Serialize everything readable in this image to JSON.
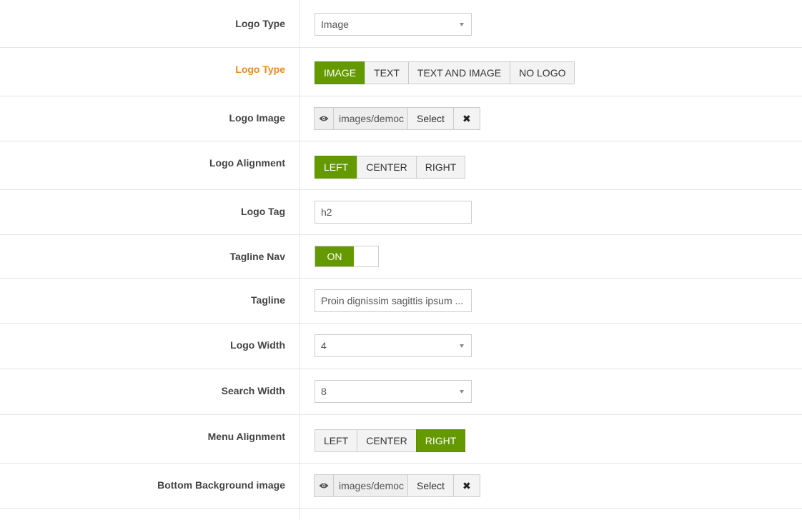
{
  "rows": {
    "logo_type_select": {
      "label": "Logo Type",
      "value": "Image"
    },
    "logo_type_buttons": {
      "label": "Logo Type",
      "options": [
        "IMAGE",
        "TEXT",
        "TEXT AND IMAGE",
        "NO LOGO"
      ],
      "selected": "IMAGE",
      "label_color": "#f08a18"
    },
    "logo_image": {
      "label": "Logo Image",
      "path": "images/democ",
      "select_label": "Select",
      "clear_label": "✖"
    },
    "logo_alignment": {
      "label": "Logo Alignment",
      "options": [
        "LEFT",
        "CENTER",
        "RIGHT"
      ],
      "selected": "LEFT"
    },
    "logo_tag": {
      "label": "Logo Tag",
      "value": "h2"
    },
    "tagline_nav": {
      "label": "Tagline Nav",
      "state": "ON"
    },
    "tagline": {
      "label": "Tagline",
      "value": "Proin dignissim sagittis ipsum  ..."
    },
    "logo_width": {
      "label": "Logo Width",
      "value": "4"
    },
    "search_width": {
      "label": "Search Width",
      "value": "8"
    },
    "menu_alignment": {
      "label": "Menu Alignment",
      "options": [
        "LEFT",
        "CENTER",
        "RIGHT"
      ],
      "selected": "RIGHT"
    },
    "bottom_bg_image": {
      "label": "Bottom Background image",
      "path": "images/democ",
      "select_label": "Select",
      "clear_label": "✖"
    }
  },
  "colors": {
    "accent": "#649a00",
    "label_highlight": "#f08a18",
    "border": "#cccccc"
  },
  "icons": {
    "preview": "eye-icon",
    "clear": "close-icon",
    "dropdown": "caret-down-icon"
  }
}
